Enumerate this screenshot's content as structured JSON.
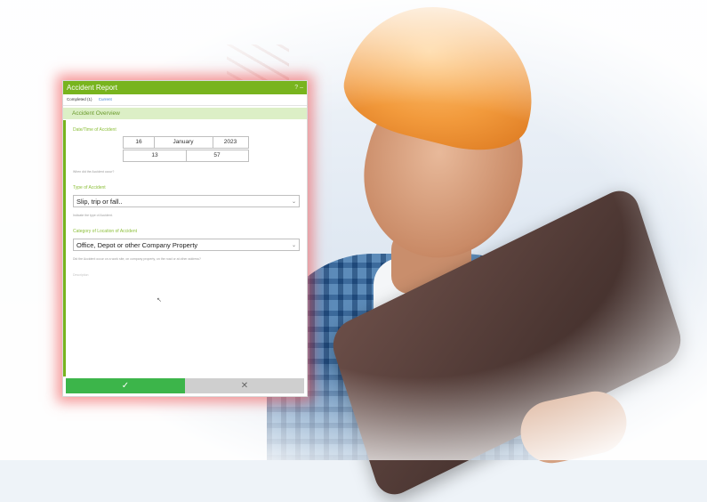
{
  "dialog": {
    "title": "Accident Report",
    "title_buttons": "? –",
    "tabs": [
      {
        "label": "Completed (1)",
        "active": false
      },
      {
        "label": "Current",
        "active": true
      }
    ],
    "section_title": "Accident Overview",
    "datetime": {
      "label": "Date/Time of Accident",
      "day": "16",
      "month": "January",
      "year": "2023",
      "hour": "13",
      "minute": "57",
      "hint": "When did the Accident occur?"
    },
    "type": {
      "label": "Type of Accident",
      "value": "Slip, trip or fall..",
      "hint": "Indicate the type of Accident."
    },
    "category": {
      "label": "Category of Location of Accident",
      "value": "Office, Depot or other Company Property",
      "hint": "Did the Accident occur on a work site, on company property, on the road or at other address?"
    },
    "extra_hint": "Description",
    "footer": {
      "ok_icon": "✓",
      "cancel_icon": "✕"
    }
  },
  "colors": {
    "accent": "#78b41e",
    "ok": "#3cb54a",
    "cancel": "#cfcfcf",
    "glow": "#f04646"
  }
}
